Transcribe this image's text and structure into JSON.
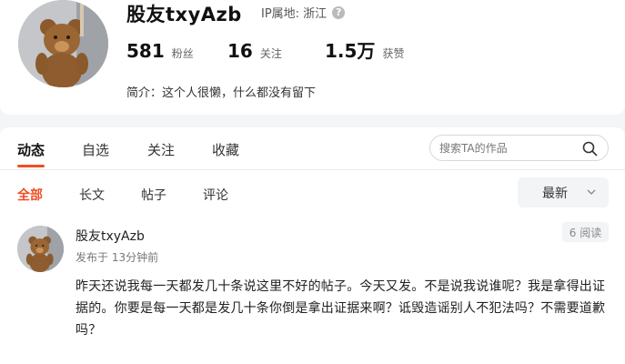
{
  "profile": {
    "name": "股友txyAzb",
    "ip_label": "IP属地: 浙江",
    "help_glyph": "?",
    "stats": [
      {
        "value": "581",
        "label": "粉丝"
      },
      {
        "value": "16",
        "label": "关注"
      },
      {
        "value": "1.5万",
        "label": "获赞"
      }
    ],
    "bio": "简介：这个人很懒，什么都没有留下"
  },
  "tabs": [
    {
      "label": "动态",
      "active": true
    },
    {
      "label": "自选",
      "active": false
    },
    {
      "label": "关注",
      "active": false
    },
    {
      "label": "收藏",
      "active": false
    }
  ],
  "search": {
    "placeholder": "搜索TA的作品",
    "icon": "search-icon"
  },
  "subtabs": [
    {
      "label": "全部",
      "active": true
    },
    {
      "label": "长文",
      "active": false
    },
    {
      "label": "帖子",
      "active": false
    },
    {
      "label": "评论",
      "active": false
    }
  ],
  "sort": {
    "label": "最新",
    "icon": "chevron-down-icon"
  },
  "post": {
    "author": "股友txyAzb",
    "time": "发布于 13分钟前",
    "reads": "6 阅读",
    "body": "昨天还说我每一天都发几十条说这里不好的帖子。今天又发。不是说我说谁呢？我是拿得出证据的。你要是每一天都是发几十条你倒是拿出证据来啊？诋毁造谣别人不犯法吗？不需要道歉吗？"
  },
  "colors": {
    "accent": "#f04e23",
    "text": "#222222",
    "muted": "#777777",
    "page_bg": "#f4f5f7"
  }
}
